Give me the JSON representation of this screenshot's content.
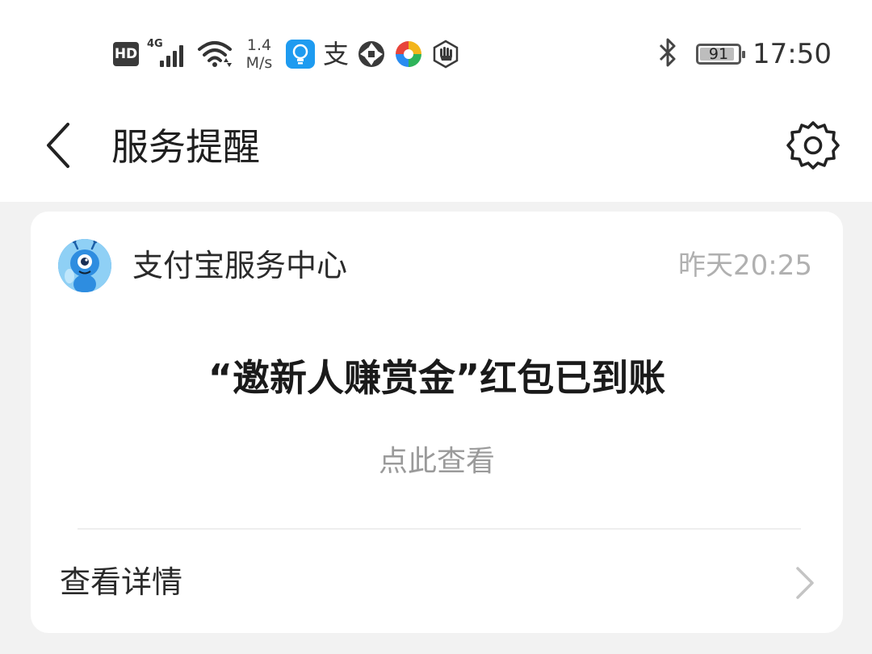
{
  "status_bar": {
    "hd_label": "HD",
    "network_label": "4G",
    "speed_value": "1.4",
    "speed_unit": "M/s",
    "battery_level": "91",
    "time": "17:50",
    "alipay_glyph": "支",
    "icons": [
      "hd-icon",
      "signal-icon",
      "wifi-icon",
      "light-bulb-app-icon",
      "alipay-icon",
      "aperture-icon",
      "pinwheel-app-icon",
      "hand-app-icon",
      "bluetooth-icon",
      "battery-icon"
    ]
  },
  "header": {
    "title": "服务提醒",
    "back_icon": "chevron-left-icon",
    "settings_icon": "gear-icon"
  },
  "message": {
    "sender": "支付宝服务中心",
    "time": "昨天20:25",
    "headline": "“邀新人赚赏金”红包已到账",
    "subtext": "点此查看",
    "detail_label": "查看详情",
    "detail_icon": "chevron-right-icon"
  },
  "colors": {
    "background": "#f2f2f2",
    "card": "#ffffff",
    "avatar_blue": "#4aa3ea",
    "muted_text": "#9a9a9a"
  }
}
